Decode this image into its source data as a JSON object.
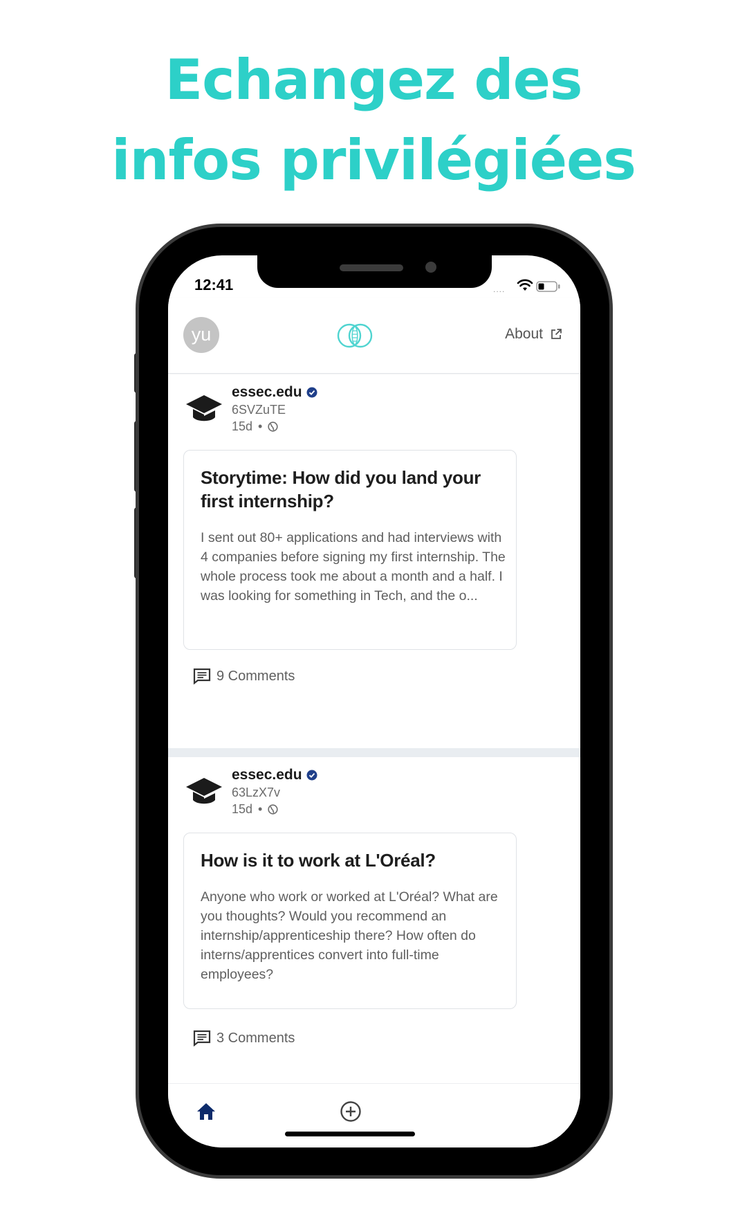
{
  "headline": {
    "line1": "Echangez des",
    "line2": "infos privilégiées"
  },
  "status_bar": {
    "time": "12:41",
    "signal": "....",
    "icons": [
      "wifi-icon",
      "battery-icon"
    ]
  },
  "header": {
    "avatar_initials": "yu",
    "about_label": "About",
    "icons": [
      "logo-icon",
      "external-link-icon"
    ]
  },
  "posts": [
    {
      "author": "essec.edu",
      "handle": "6SVZuTE",
      "age": "15d",
      "separator": "•",
      "title": "Storytime: How did you land your first internship?",
      "body": "I sent out 80+ applications and had interviews with 4 companies before signing my first internship. The whole process took me about a month and a half. I was looking for something in Tech, and the o...",
      "comments": "9 Comments"
    },
    {
      "author": "essec.edu",
      "handle": "63LzX7v",
      "age": "15d",
      "separator": "•",
      "title": "How is it to work at L'Oréal?",
      "body": "Anyone who work or worked at L'Oréal? What are you thoughts? Would you recommend an internship/apprenticeship there? How often do interns/apprentices convert into full-time employees?",
      "comments": "3 Comments"
    }
  ],
  "tab_bar": {
    "items": [
      "home-icon",
      "add-icon"
    ],
    "active": "home-icon"
  },
  "colors": {
    "headline": "#2dd0c8",
    "brand_navy": "#0d2b6b",
    "logo_teal": "#4fd4d0",
    "verified": "#1f3f8a"
  }
}
